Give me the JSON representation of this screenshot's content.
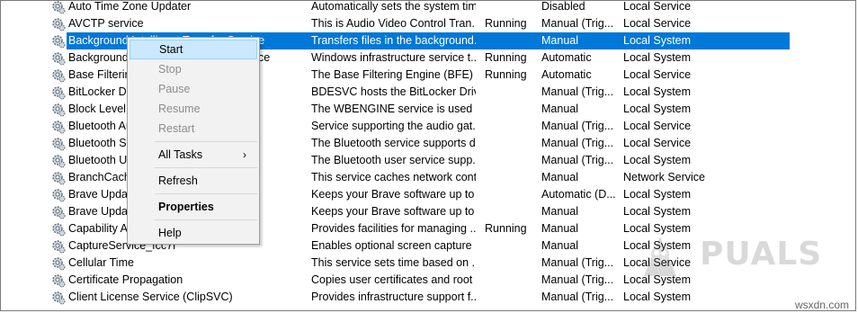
{
  "services": [
    {
      "name": "Auto Time Zone Updater",
      "description": "Automatically sets the system time...",
      "status": "",
      "startup": "Disabled",
      "logon": "Local Service"
    },
    {
      "name": "AVCTP service",
      "description": "This is Audio Video Control Tran...",
      "status": "Running",
      "startup": "Manual (Trig...",
      "logon": "Local Service"
    },
    {
      "name": "Background Intelligent Transfer Service",
      "description": "Transfers files in the background...",
      "status": "",
      "startup": "Manual",
      "logon": "Local System",
      "selected": true
    },
    {
      "name": "Background Tasks Infrastructure Service",
      "description": "Windows infrastructure service t...",
      "status": "Running",
      "startup": "Automatic",
      "logon": "Local System"
    },
    {
      "name": "Base Filtering Engine",
      "description": "The Base Filtering Engine (BFE) is...",
      "status": "Running",
      "startup": "Automatic",
      "logon": "Local Service"
    },
    {
      "name": "BitLocker Drive Encryption Service",
      "description": "BDESVC hosts the BitLocker Driv...",
      "status": "",
      "startup": "Manual (Trig...",
      "logon": "Local System"
    },
    {
      "name": "Block Level Backup Engine Service",
      "description": "The WBENGINE service is used b...",
      "status": "",
      "startup": "Manual",
      "logon": "Local System"
    },
    {
      "name": "Bluetooth Audio Gateway Service",
      "description": "Service supporting the audio gat...",
      "status": "",
      "startup": "Manual (Trig...",
      "logon": "Local Service"
    },
    {
      "name": "Bluetooth Support Service",
      "description": "The Bluetooth service supports d...",
      "status": "",
      "startup": "Manual (Trig...",
      "logon": "Local Service"
    },
    {
      "name": "Bluetooth User Support Service",
      "description": "The Bluetooth user service supp...",
      "status": "",
      "startup": "Manual (Trig...",
      "logon": "Local System"
    },
    {
      "name": "BranchCache",
      "description": "This service caches network cont...",
      "status": "",
      "startup": "Manual",
      "logon": "Network Service"
    },
    {
      "name": "Brave Update Service (brave)",
      "description": "Keeps your Brave software up to ...",
      "status": "",
      "startup": "Automatic (D...",
      "logon": "Local System"
    },
    {
      "name": "Brave Update Service (bravem)",
      "description": "Keeps your Brave software up to ...",
      "status": "",
      "startup": "Manual",
      "logon": "Local System"
    },
    {
      "name": "Capability Access Manager Service",
      "description": "Provides facilities for managing ...",
      "status": "Running",
      "startup": "Manual",
      "logon": "Local System"
    },
    {
      "name": "CaptureService_fcc7f",
      "description": "Enables optional screen capture ...",
      "status": "",
      "startup": "Manual",
      "logon": "Local System"
    },
    {
      "name": "Cellular Time",
      "description": "This service sets time based on ...",
      "status": "",
      "startup": "Manual (Trig...",
      "logon": "Local Service"
    },
    {
      "name": "Certificate Propagation",
      "description": "Copies user certificates and root ...",
      "status": "",
      "startup": "Manual (Trig...",
      "logon": "Local System"
    },
    {
      "name": "Client License Service (ClipSVC)",
      "description": "Provides infrastructure support f...",
      "status": "",
      "startup": "Manual (Trig...",
      "logon": "Local System"
    }
  ],
  "context_menu": {
    "start": "Start",
    "stop": "Stop",
    "pause": "Pause",
    "resume": "Resume",
    "restart": "Restart",
    "all_tasks": "All Tasks",
    "all_tasks_arrow": "›",
    "refresh": "Refresh",
    "properties": "Properties",
    "help": "Help"
  },
  "watermark": {
    "text": "PUALS"
  },
  "footer": {
    "text": "wsxdn.com"
  },
  "colors": {
    "selection": "#0078d7",
    "menu_hot": "#cce8ff"
  }
}
